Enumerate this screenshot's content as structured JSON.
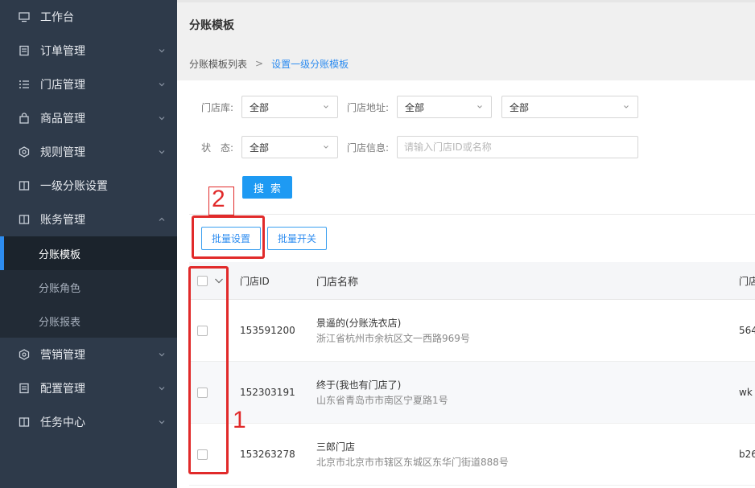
{
  "sidebar": {
    "items": [
      {
        "label": "工作台",
        "icon": "monitor-icon",
        "has_arrow": false
      },
      {
        "label": "订单管理",
        "icon": "order-icon",
        "has_arrow": true
      },
      {
        "label": "门店管理",
        "icon": "list-icon",
        "has_arrow": true
      },
      {
        "label": "商品管理",
        "icon": "bag-icon",
        "has_arrow": true
      },
      {
        "label": "规则管理",
        "icon": "rule-icon",
        "has_arrow": true
      },
      {
        "label": "一级分账设置",
        "icon": "settlement-icon",
        "has_arrow": false
      },
      {
        "label": "账务管理",
        "icon": "finance-icon",
        "has_arrow": true,
        "expanded": true
      }
    ],
    "sub_items": [
      {
        "label": "分账模板",
        "active": true
      },
      {
        "label": "分账角色",
        "active": false
      },
      {
        "label": "分账报表",
        "active": false
      }
    ],
    "items_after": [
      {
        "label": "营销管理",
        "icon": "marketing-icon",
        "has_arrow": true
      },
      {
        "label": "配置管理",
        "icon": "config-icon",
        "has_arrow": true
      },
      {
        "label": "任务中心",
        "icon": "task-icon",
        "has_arrow": true
      }
    ]
  },
  "header": {
    "title": "分账模板"
  },
  "breadcrumb": {
    "parent": "分账模板列表",
    "separator": ">",
    "current": "设置一级分账模板"
  },
  "filters": {
    "store_lib_label": "门店库:",
    "store_lib_value": "全部",
    "store_addr_label": "门店地址:",
    "store_addr_value1": "全部",
    "store_addr_value2": "全部",
    "status_label": "状　态:",
    "status_value": "全部",
    "store_info_label": "门店信息:",
    "store_info_placeholder": "请输入门店ID或名称",
    "search_label": "搜索"
  },
  "actions": {
    "batch_set": "批量设置",
    "batch_switch": "批量开关"
  },
  "table": {
    "headers": {
      "id": "门店ID",
      "name": "门店名称",
      "extra": "门店"
    },
    "rows": [
      {
        "id": "153591200",
        "name": "景遥的(分账洗衣店)",
        "address": "浙江省杭州市余杭区文一西路969号",
        "extra": "564"
      },
      {
        "id": "152303191",
        "name": "终于(我也有门店了)",
        "address": "山东省青岛市市南区宁夏路1号",
        "extra": "wk"
      },
      {
        "id": "153263278",
        "name": "三郎门店",
        "address": "北京市北京市市辖区东城区东华门街道888号",
        "extra": "b26"
      }
    ]
  },
  "annotations": {
    "label1": "1",
    "label2": "2",
    "color": "#e12a2a"
  },
  "colors": {
    "sidebar_bg": "#2e3a4a",
    "accent": "#2d8cf0",
    "search_btn": "#1e9af3"
  }
}
